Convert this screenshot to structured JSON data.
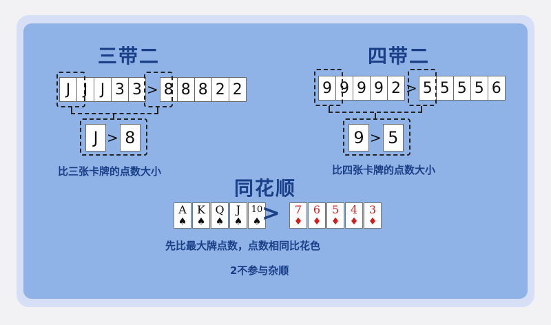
{
  "left": {
    "title": "三带二",
    "cards_a": [
      "J",
      "J",
      "J",
      "3",
      "3"
    ],
    "cards_b": [
      "8",
      "8",
      "8",
      "2",
      "2"
    ],
    "gt": ">",
    "compare": [
      "J",
      ">",
      "8"
    ],
    "caption": "比三张卡牌的点数大小"
  },
  "right": {
    "title": "四带二",
    "cards_a": [
      "9",
      "9",
      "9",
      "9",
      "2"
    ],
    "cards_b": [
      "5",
      "5",
      "5",
      "5",
      "6"
    ],
    "gt": ">",
    "compare": [
      "9",
      ">",
      "5"
    ],
    "caption": "比四张卡牌的点数大小"
  },
  "center": {
    "title": "同花顺",
    "spade_cards": [
      {
        "rank": "A",
        "suit": "♠"
      },
      {
        "rank": "K",
        "suit": "♠"
      },
      {
        "rank": "Q",
        "suit": "♠"
      },
      {
        "rank": "J",
        "suit": "♠"
      },
      {
        "rank": "10",
        "suit": "♠"
      }
    ],
    "gt": ">",
    "diamond_cards": [
      {
        "rank": "7",
        "suit": "♦"
      },
      {
        "rank": "6",
        "suit": "♦"
      },
      {
        "rank": "5",
        "suit": "♦"
      },
      {
        "rank": "4",
        "suit": "♦"
      },
      {
        "rank": "3",
        "suit": "♦"
      }
    ],
    "caption1": "先比最大牌点数，点数相同比花色",
    "caption2": "2不参与杂顺"
  },
  "colors": {
    "panel": "#8fb3e6",
    "title": "#1a3f86",
    "red_suit": "#d21d1d"
  }
}
